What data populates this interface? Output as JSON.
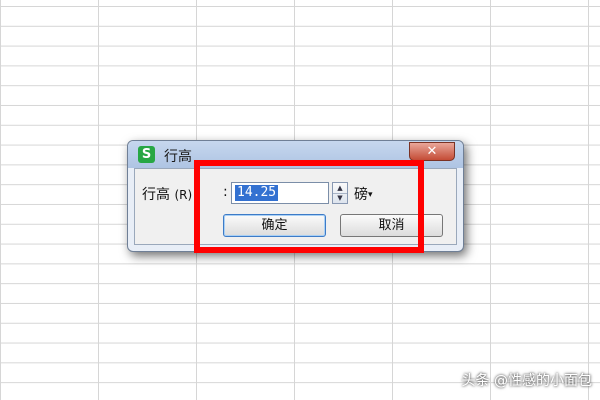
{
  "dialog": {
    "app_icon_letter": "S",
    "title": "行高",
    "close_symbol": "✕",
    "field_label": "行高",
    "field_shortcut": "(R)",
    "colon": ":",
    "value": "14.25",
    "unit": "磅",
    "unit_caret": "▾",
    "spin_up": "▲",
    "spin_down": "▼",
    "ok_label": "确定",
    "cancel_label": "取消"
  },
  "watermark": "头条 @性感的小面包",
  "colors": {
    "highlight": "#ff0000",
    "app_icon": "#27a744",
    "selection": "#3371d1",
    "close_button": "#c44c36"
  }
}
